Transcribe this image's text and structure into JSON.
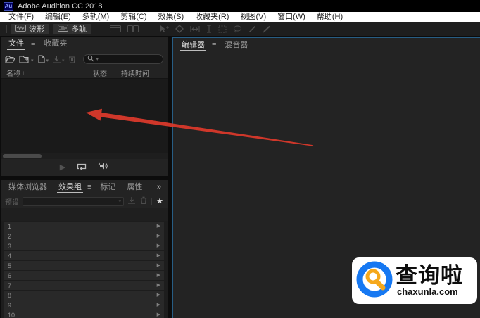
{
  "window": {
    "title": "Adobe Audition CC 2018",
    "app_icon_label": "Au"
  },
  "menu_bar": {
    "items": [
      "文件(F)",
      "编辑(E)",
      "多轨(M)",
      "剪辑(C)",
      "效果(S)",
      "收藏夹(R)",
      "视图(V)",
      "窗口(W)",
      "帮助(H)"
    ]
  },
  "toolbar": {
    "waveform_label": "波形",
    "multitrack_label": "多轨"
  },
  "files_panel": {
    "tab_files": "文件",
    "tab_favorites": "收藏夹",
    "search_value": "",
    "columns": {
      "name": "名称",
      "status": "状态",
      "duration": "持续时间"
    }
  },
  "effects_panel": {
    "tab_media_browser": "媒体浏览器",
    "tab_effects_rack": "效果组",
    "tab_markers": "标记",
    "tab_properties": "属性",
    "presets_label": "预设",
    "presets_value": "",
    "rack_slots": [
      "1",
      "2",
      "3",
      "4",
      "5",
      "6",
      "7",
      "8",
      "9",
      "10"
    ]
  },
  "editor_panel": {
    "tab_editor": "编辑器",
    "tab_mixer": "混音器"
  },
  "watermark": {
    "brand": "查询啦",
    "domain": "chaxunla.com"
  },
  "icons": {
    "hamburger": "≡",
    "overflow": "»",
    "chevron_down": "▾",
    "sort_up": "↑",
    "star": "★",
    "play": "▶",
    "row_arrow": "▶"
  },
  "colors": {
    "accent_panel_focus_blue": "#275d84",
    "arrow_red": "#d9392b",
    "menu_bar_bg": "#ffffff",
    "watermark_blue": "#1678f2",
    "watermark_orange": "#f5a81c"
  }
}
